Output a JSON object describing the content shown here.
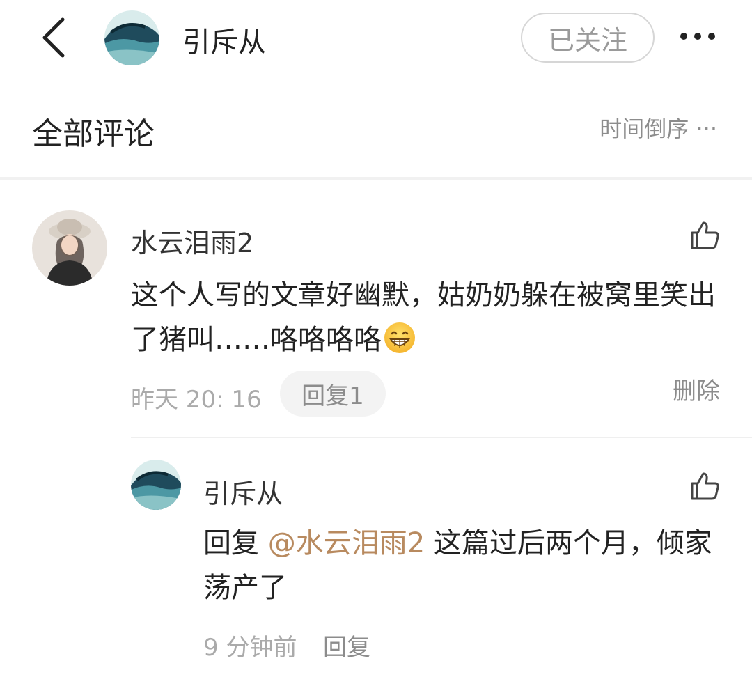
{
  "header": {
    "username": "引斥从",
    "follow_label": "已关注",
    "back_icon": "chevron-left-icon",
    "more_icon": "more-horizontal-icon"
  },
  "comments_section": {
    "title": "全部评论",
    "sort_label": "时间倒序 ···"
  },
  "comment": {
    "author": "水云泪雨2",
    "text": "这个人写的文章好幽默，姑奶奶躲在被窝里笑出了猪叫……咯咯咯咯",
    "emoji": "grinning-face-emoji",
    "time": "昨天 20: 16",
    "reply_label": "回复1",
    "delete_label": "删除",
    "like_icon": "thumbs-up-icon"
  },
  "reply": {
    "author": "引斥从",
    "prefix": "回复 ",
    "mention": "@水云泪雨2",
    "text": " 这篇过后两个月，倾家荡产了",
    "time": "9 分钟前",
    "reply_label": "回复",
    "like_icon": "thumbs-up-icon"
  },
  "colors": {
    "mention": "#b88a5f",
    "muted_text": "#8c8c8c",
    "separator": "#f1f1f1"
  }
}
